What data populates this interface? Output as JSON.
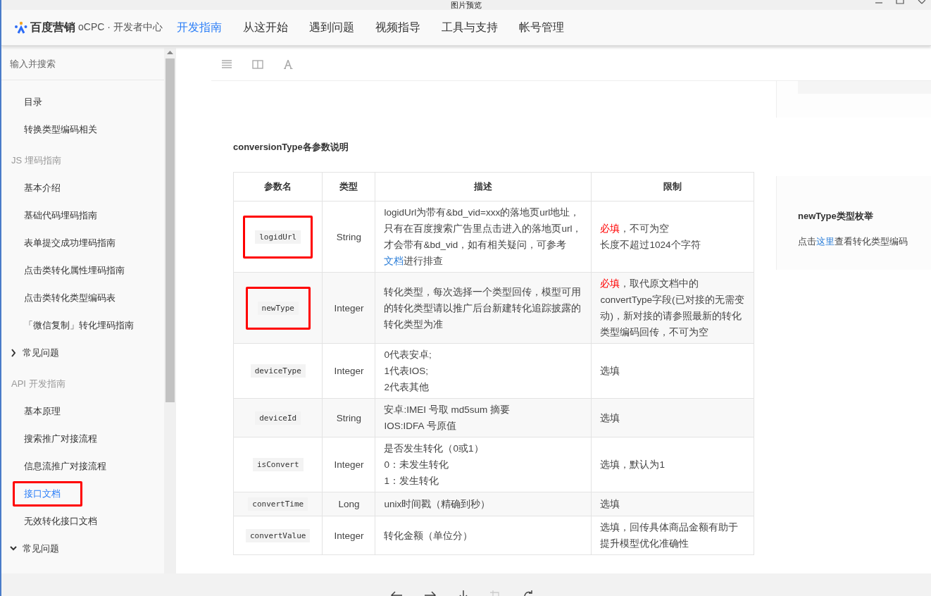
{
  "window": {
    "title": "图片预览"
  },
  "header": {
    "brand": "百度营销",
    "product": "oCPC · 开发者中心",
    "nav": [
      {
        "label": "开发指南",
        "selected": true
      },
      {
        "label": "从这开始",
        "selected": false
      },
      {
        "label": "遇到问题",
        "selected": false
      },
      {
        "label": "视频指导",
        "selected": false
      },
      {
        "label": "工具与支持",
        "selected": false
      },
      {
        "label": "帐号管理",
        "selected": false
      }
    ]
  },
  "sidebar": {
    "search": {
      "placeholder": "输入并搜索"
    },
    "items": [
      {
        "kind": "item",
        "label": "目录",
        "selected": false,
        "highlighted": false
      },
      {
        "kind": "item",
        "label": "转换类型编码相关",
        "selected": false,
        "highlighted": false
      },
      {
        "kind": "group",
        "label": "JS 埋码指南"
      },
      {
        "kind": "item",
        "label": "基本介绍",
        "selected": false,
        "highlighted": false
      },
      {
        "kind": "item",
        "label": "基础代码埋码指南",
        "selected": false,
        "highlighted": false
      },
      {
        "kind": "item",
        "label": "表单提交成功埋码指南",
        "selected": false,
        "highlighted": false
      },
      {
        "kind": "item",
        "label": "点击类转化属性埋码指南",
        "selected": false,
        "highlighted": false
      },
      {
        "kind": "item",
        "label": "点击类转化类型编码表",
        "selected": false,
        "highlighted": false
      },
      {
        "kind": "item",
        "label": "「微信复制」转化埋码指南",
        "selected": false,
        "highlighted": false
      },
      {
        "kind": "toggle",
        "label": "常见问题",
        "expanded": false
      },
      {
        "kind": "group",
        "label": "API 开发指南"
      },
      {
        "kind": "item",
        "label": "基本原理",
        "selected": false,
        "highlighted": false
      },
      {
        "kind": "item",
        "label": "搜索推广对接流程",
        "selected": false,
        "highlighted": false
      },
      {
        "kind": "item",
        "label": "信息流推广对接流程",
        "selected": false,
        "highlighted": false
      },
      {
        "kind": "item",
        "label": "接口文档",
        "selected": true,
        "highlighted": true
      },
      {
        "kind": "item",
        "label": "无效转化接口文档",
        "selected": false,
        "highlighted": false
      },
      {
        "kind": "toggle",
        "label": "常见问题",
        "expanded": true
      }
    ]
  },
  "main": {
    "heading": "conversionType各参数说明",
    "table": {
      "columns": [
        "参数名",
        "类型",
        "描述",
        "限制"
      ],
      "rows": [
        {
          "name": "logidUrl",
          "type": "String",
          "highlighted": true,
          "description": [
            "logidUrl为带有&bd_vid=xxx的落地页url地址，只有在百度搜索广告里点击进入的落地页url，才会带有&bd_vid，如有相关疑问，可参考"
          ],
          "link": "文档",
          "after": "进行排查",
          "required": "必填",
          "limit": [
            "，不可为空",
            "长度不超过1024个字符"
          ]
        },
        {
          "name": "newType",
          "type": "Integer",
          "highlighted": true,
          "description": [
            "转化类型，每次选择一个类型回传，模型可用的转化类型请以推广后台新建转化追踪披露的转化类型为准"
          ],
          "required": "必填",
          "limit": [
            "，取代原文档中的convertType字段(已对接的无需变动)，新对接的请参照最新的转化类型编码回传，不可为空"
          ]
        },
        {
          "name": "deviceType",
          "type": "Integer",
          "highlighted": false,
          "description": [
            "0代表安卓;",
            "1代表IOS;",
            "2代表其他"
          ],
          "limit": [
            "选填"
          ]
        },
        {
          "name": "deviceId",
          "type": "String",
          "highlighted": false,
          "description": [
            "安卓:IMEI 号取 md5sum 摘要",
            "IOS:IDFA 号原值"
          ],
          "limit": [
            "选填"
          ]
        },
        {
          "name": "isConvert",
          "type": "Integer",
          "highlighted": false,
          "description": [
            "是否发生转化（0或1）",
            "0：未发生转化",
            "1：发生转化"
          ],
          "limit": [
            "选填，默认为1"
          ]
        },
        {
          "name": "convertTime",
          "type": "Long",
          "highlighted": false,
          "description": [
            "unix时间戳（精确到秒）"
          ],
          "limit": [
            "选填"
          ]
        },
        {
          "name": "convertValue",
          "type": "Integer",
          "highlighted": false,
          "description": [
            "转化金额（单位分）"
          ],
          "limit": [
            "选填，回传具体商品金额有助于提升模型优化准确性"
          ]
        }
      ]
    }
  },
  "aside": {
    "title": "newType类型枚举",
    "before": "点击",
    "link": "这里",
    "after": "查看转化类型编码"
  }
}
